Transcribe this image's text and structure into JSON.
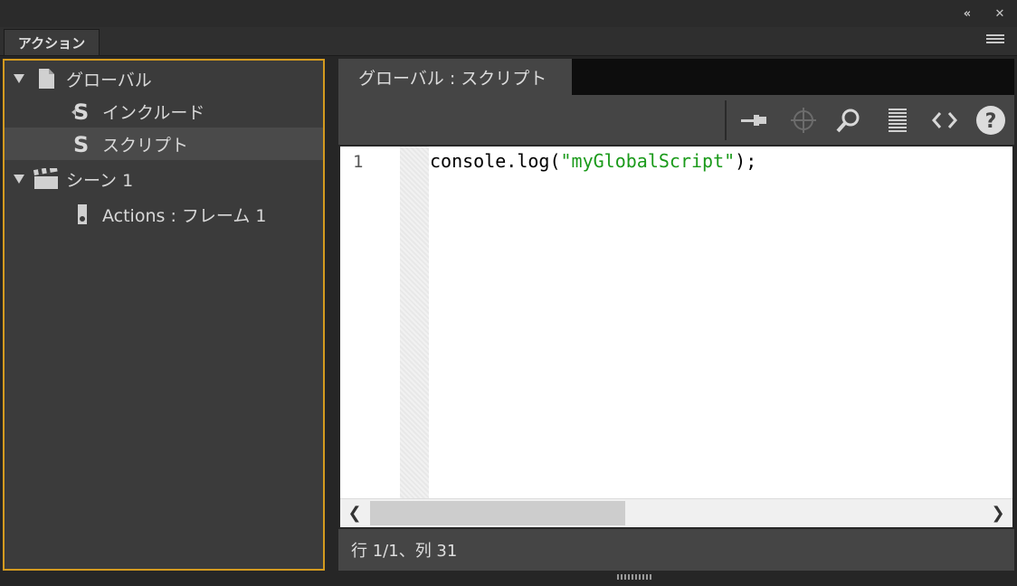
{
  "panel": {
    "tab_label": "アクション"
  },
  "tree": {
    "items": [
      {
        "label": "グローバル",
        "icon": "document-icon",
        "expanded": true
      },
      {
        "label": "インクルード",
        "icon": "script-icon"
      },
      {
        "label": "スクリプト",
        "icon": "script-icon",
        "selected": true
      },
      {
        "label": "シーン 1",
        "icon": "clapper-icon",
        "expanded": true
      },
      {
        "label": "Actions : フレーム 1",
        "icon": "frame-icon"
      }
    ]
  },
  "editor": {
    "tab_label": "グローバル : スクリプト",
    "toolbar": [
      "pin-icon",
      "target-icon",
      "search-icon",
      "format-icon",
      "code-snippets-icon",
      "help-icon"
    ],
    "line_number": "1",
    "code_prefix": "console.log(",
    "code_string": "\"myGlobalScript\"",
    "code_suffix": ");",
    "status": "行 1/1、列 31"
  },
  "colors": {
    "accent_border": "#d39a1f",
    "string": "#1a9a1a"
  }
}
